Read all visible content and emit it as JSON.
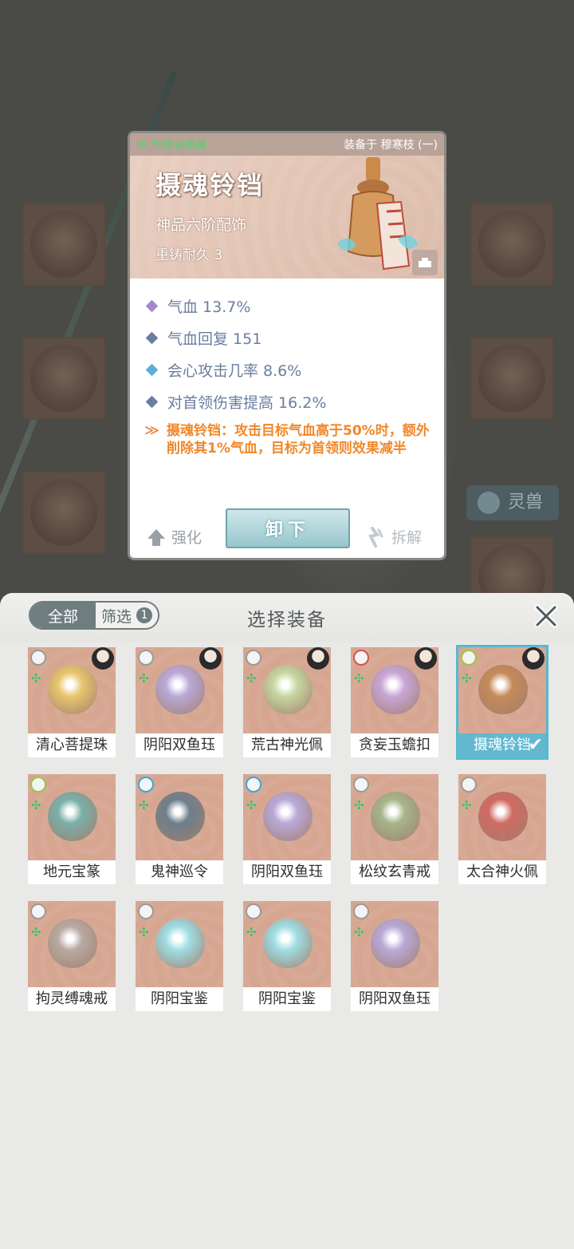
{
  "background": {
    "side_button": "灵兽"
  },
  "detail": {
    "collect_label": "可收录图鉴",
    "equipped_label": "装备于 穆寒枝 (一)",
    "name": "摄魂铃铛",
    "grade": "神品六阶配饰",
    "durability": "重铸耐久 3",
    "stats": [
      {
        "text": "气血 13.7%",
        "color": "#a58ac9"
      },
      {
        "text": "气血回复 151",
        "color": "#6a7ea0"
      },
      {
        "text": "会心攻击几率 8.6%",
        "color": "#5aaedc"
      },
      {
        "text": "对首领伤害提高 16.2%",
        "color": "#6a7ea0"
      }
    ],
    "special_text": "摄魂铃铛：攻击目标气血高于50%时，额外削除其1%气血，目标为首领则效果减半",
    "enhance_label": "强化",
    "unequip_label": "卸下",
    "dismantle_label": "拆解"
  },
  "panel": {
    "tab_all": "全部",
    "tab_filter": "筛选",
    "filter_count": "1",
    "title": "选择装备"
  },
  "items": [
    {
      "name": "清心菩提珠",
      "type_color": "#9a9a9a",
      "owner": true,
      "art": "#e8c66e"
    },
    {
      "name": "阴阳双鱼珏",
      "type_color": "#9a9a9a",
      "owner": true,
      "art": "#b9a9d8"
    },
    {
      "name": "荒古神光佩",
      "type_color": "#9a9a9a",
      "owner": true,
      "art": "#c7d7a0"
    },
    {
      "name": "贪妄玉蟾扣",
      "type_color": "#d95050",
      "owner": true,
      "art": "#c9a6d6"
    },
    {
      "name": "摄魂铃铛",
      "type_color": "#9bc83c",
      "owner": true,
      "art": "#c58a5a",
      "selected": true
    },
    {
      "name": "地元宝篆",
      "type_color": "#9bc83c",
      "owner": false,
      "art": "#7ab0a8"
    },
    {
      "name": "鬼神巡令",
      "type_color": "#3aa6d8",
      "owner": false,
      "art": "#6c7f8c"
    },
    {
      "name": "阴阳双鱼珏",
      "type_color": "#3aa6d8",
      "owner": false,
      "art": "#b9a9d8"
    },
    {
      "name": "松纹玄青戒",
      "type_color": "#9a9a9a",
      "owner": false,
      "art": "#a6b58a"
    },
    {
      "name": "太合神火佩",
      "type_color": "#9a9a9a",
      "owner": false,
      "art": "#d06a62"
    },
    {
      "name": "拘灵缚魂戒",
      "type_color": "#9a9a9a",
      "owner": false,
      "art": "#b8aaa2"
    },
    {
      "name": "阴阳宝鉴",
      "type_color": "#9a9a9a",
      "owner": false,
      "art": "#9fdde3"
    },
    {
      "name": "阴阳宝鉴",
      "type_color": "#9a9a9a",
      "owner": false,
      "art": "#9fdde3"
    },
    {
      "name": "阴阳双鱼珏",
      "type_color": "#9a9a9a",
      "owner": false,
      "art": "#b9a9d8"
    }
  ]
}
